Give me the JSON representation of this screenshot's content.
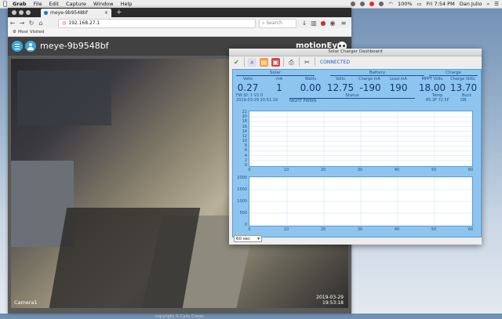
{
  "menubar": {
    "app": "Grab",
    "items": [
      "File",
      "Edit",
      "Capture",
      "Window",
      "Help"
    ],
    "battery": "100%",
    "clock": "Fri 7:54 PM",
    "user": "Dan Julio"
  },
  "browser": {
    "tab_title": "meye-9b9548bf",
    "url": "192.168.27.1",
    "search_placeholder": "Search",
    "bookmark": "Most Visited"
  },
  "motioneye": {
    "device_name": "meye-9b9548bf",
    "brand": "motionEye",
    "camera_name": "Camera1",
    "camera_time_1": "2019-03-29",
    "camera_time_2": "19:53:18",
    "copyright": "copyright © Calin Crisan"
  },
  "solar": {
    "window_title": "Solar Charger Dashboard",
    "status": "CONNECTED",
    "groups": {
      "solar": "Solar",
      "battery": "Battery",
      "charge": "Charge",
      "status": "Status"
    },
    "labels": [
      "Volts",
      "mA",
      "Watts",
      "Volts",
      "Charge mA",
      "Load mA",
      "MPPT Volts",
      "Charge Volts"
    ],
    "values": [
      "0.27",
      "1",
      "0.00",
      "12.75",
      "-190",
      "190",
      "18.00",
      "13.70"
    ],
    "fw": "FW ID: 1 V1.0",
    "timestamp": "2019-03-29 20:51:29",
    "night": "NIGHT PWRIN",
    "temp_label": "Temp",
    "buck_label": "Buck",
    "temp": "65.3F 72.5F",
    "buck": "ON",
    "dropdown": "60 sec"
  },
  "chart_data": [
    {
      "type": "line",
      "x": [
        0,
        10,
        20,
        30,
        40,
        50,
        60
      ],
      "yticks": [
        0,
        2,
        4,
        6,
        8,
        10,
        12,
        14,
        16,
        18,
        20,
        22
      ],
      "xlim": [
        0,
        60
      ],
      "ylim": [
        0,
        22
      ],
      "series": []
    },
    {
      "type": "line",
      "x": [
        0,
        10,
        20,
        30,
        40,
        50,
        60
      ],
      "yticks": [
        0,
        500,
        1000,
        1500,
        2000
      ],
      "xlim": [
        0,
        60
      ],
      "ylim": [
        0,
        2000
      ],
      "series": []
    }
  ]
}
